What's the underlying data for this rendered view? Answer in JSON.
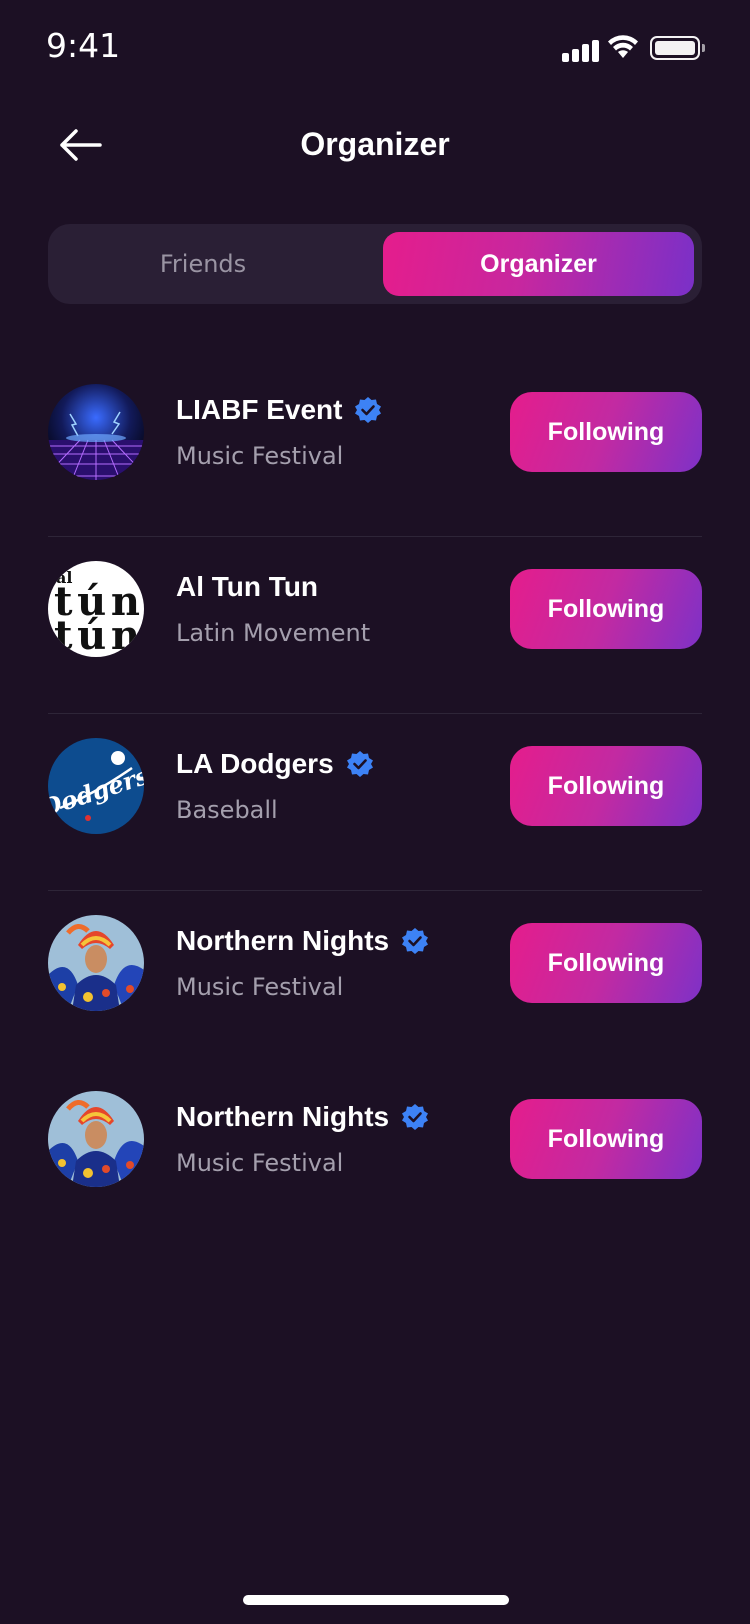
{
  "status_bar": {
    "time": "9:41"
  },
  "header": {
    "title": "Organizer"
  },
  "tabs": [
    {
      "label": "Friends",
      "active": false
    },
    {
      "label": "Organizer",
      "active": true
    }
  ],
  "organizers": [
    {
      "name": "LIABF Event",
      "subtitle": "Music Festival",
      "verified": true,
      "button": "Following",
      "avatar": "neon-grid"
    },
    {
      "name": "Al Tun Tun",
      "subtitle": "Latin Movement",
      "verified": false,
      "button": "Following",
      "avatar": "al-tun-tun-logo"
    },
    {
      "name": "LA Dodgers",
      "subtitle": "Baseball",
      "verified": true,
      "button": "Following",
      "avatar": "dodgers-logo"
    },
    {
      "name": "Northern Nights",
      "subtitle": "Music Festival",
      "verified": true,
      "button": "Following",
      "avatar": "dancer-photo"
    },
    {
      "name": "Northern Nights",
      "subtitle": "Music Festival",
      "verified": true,
      "button": "Following",
      "avatar": "dancer-photo"
    }
  ],
  "avatar_text": {
    "al_tun_tun": [
      "al",
      "tún",
      "tún"
    ],
    "dodgers": "Dodgers"
  },
  "colors": {
    "background": "#1c1024",
    "accent_start": "#e51d8c",
    "accent_end": "#7a30c8",
    "verified": "#3d82f5"
  }
}
